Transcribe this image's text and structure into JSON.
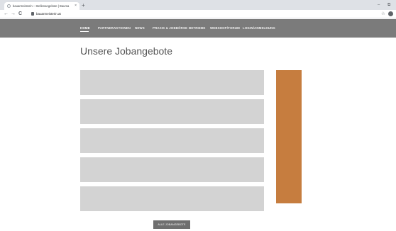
{
  "browser": {
    "tab_title": "bauarmeisterin – Stellenangebote | Bauma",
    "url": "bauarmeisterin.at",
    "new_tab_glyph": "+",
    "close_glyph": "×",
    "minimize_glyph": "–",
    "restore_glyph": "⧉",
    "back_glyph": "←",
    "forward_glyph": "→",
    "reload_glyph": "C",
    "bookmark_glyph": "☆"
  },
  "nav": {
    "items": [
      {
        "label": "HOME",
        "active": true
      },
      {
        "label": "PARTNERAKTIONEN"
      },
      {
        "label": "NEWS"
      },
      {
        "label": "PRAXIS & JOBBÖRSE"
      },
      {
        "label": "BETRIEBE"
      },
      {
        "label": "WEBSHOP/FORUM"
      },
      {
        "label": "LOGIN/ANMELDUNG"
      }
    ]
  },
  "page": {
    "title": "Unsere Jobangebote",
    "more_button": "ALLE JOBANGEBOTE"
  },
  "colors": {
    "nav_bg": "#7b7b7b",
    "card_bg": "#d3d3d3",
    "accent": "#c67d3f",
    "button_bg": "#6f6f6f"
  }
}
